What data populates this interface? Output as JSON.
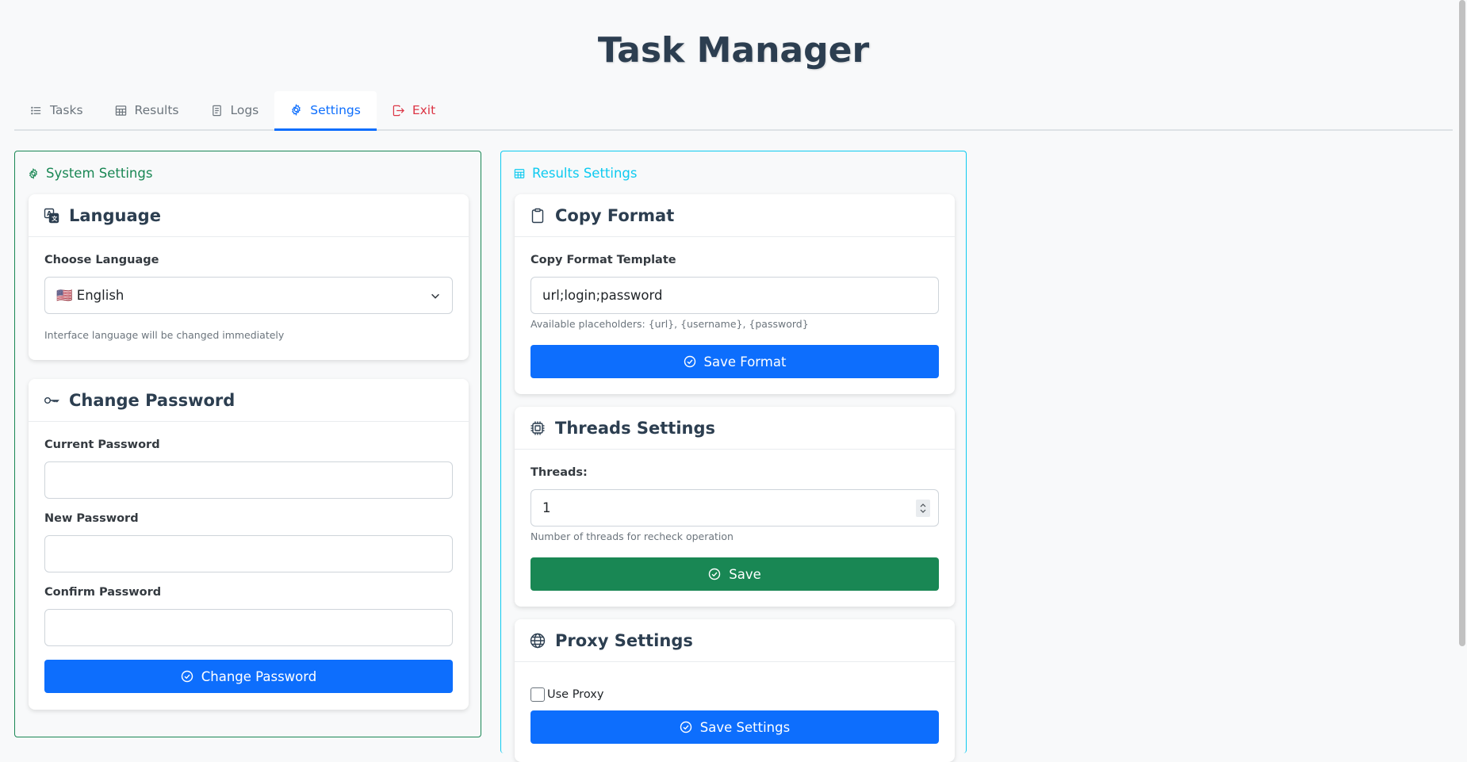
{
  "app": {
    "title": "Task Manager"
  },
  "tabs": [
    {
      "label": "Tasks",
      "icon": "list-icon"
    },
    {
      "label": "Results",
      "icon": "table-icon"
    },
    {
      "label": "Logs",
      "icon": "document-icon"
    },
    {
      "label": "Settings",
      "icon": "gear-icon",
      "active": true
    },
    {
      "label": "Exit",
      "icon": "logout-icon"
    }
  ],
  "system": {
    "header": "System Settings",
    "language": {
      "title": "Language",
      "label": "Choose Language",
      "value": "🇺🇸 English",
      "help": "Interface language will be changed immediately"
    },
    "password": {
      "title": "Change Password",
      "current_label": "Current Password",
      "new_label": "New Password",
      "confirm_label": "Confirm Password",
      "button": "Change Password"
    }
  },
  "results": {
    "header": "Results Settings",
    "copy_format": {
      "title": "Copy Format",
      "label": "Copy Format Template",
      "value": "url;login;password",
      "help": "Available placeholders: {url}, {username}, {password}",
      "button": "Save Format"
    },
    "threads": {
      "title": "Threads Settings",
      "label": "Threads:",
      "value": "1",
      "help": "Number of threads for recheck operation",
      "button": "Save"
    },
    "proxy": {
      "title": "Proxy Settings",
      "checkbox_label": "Use Proxy",
      "button": "Save Settings"
    }
  },
  "colors": {
    "primary": "#0d6efd",
    "success": "#198754",
    "info": "#0dcaf0",
    "danger": "#dc3545",
    "title": "#2c3e50"
  }
}
